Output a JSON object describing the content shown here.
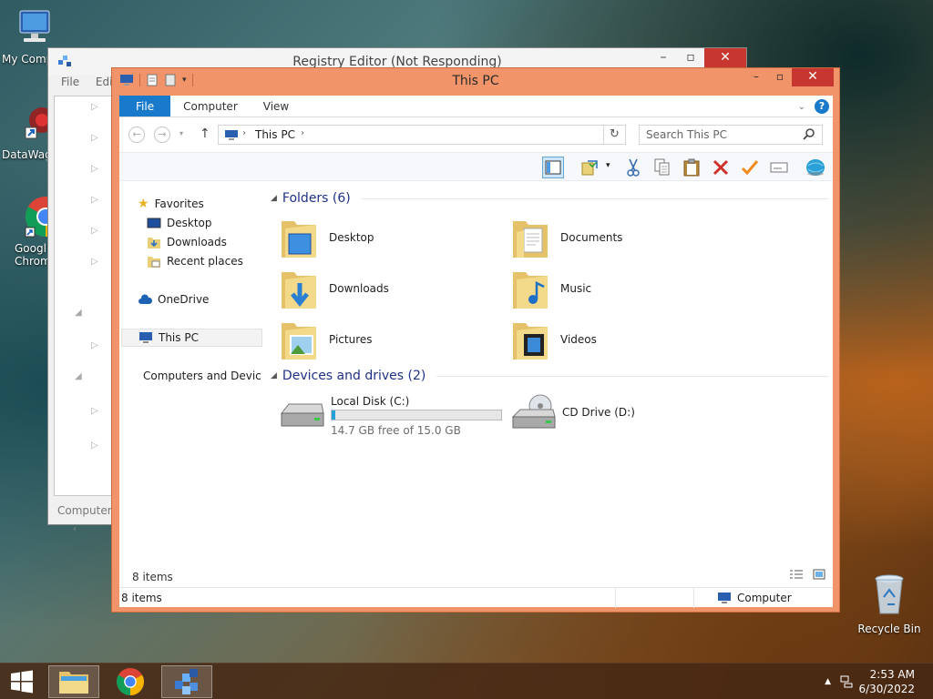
{
  "desktop": {
    "icons": [
      {
        "label": "My Comp",
        "icon": "computer-icon"
      },
      {
        "label": "DataWag",
        "icon": "datawag-icon"
      },
      {
        "label": "Googl Chrom",
        "icon": "chrome-icon"
      },
      {
        "label": "Recycle Bin",
        "icon": "recycle-bin-icon"
      }
    ]
  },
  "regedit": {
    "title": "Registry Editor (Not Responding)",
    "menu": [
      "File",
      "Edit"
    ],
    "status": "Computer\\"
  },
  "explorer": {
    "title": "This PC",
    "tabs": {
      "file": "File",
      "computer": "Computer",
      "view": "View"
    },
    "address": {
      "crumb": "This PC"
    },
    "search": {
      "placeholder": "Search This PC"
    },
    "nav": {
      "favorites": "Favorites",
      "desktop": "Desktop",
      "downloads": "Downloads",
      "recent": "Recent places",
      "onedrive": "OneDrive",
      "thispc": "This PC",
      "network": "Computers and Devices"
    },
    "folders_header": "Folders (6)",
    "folders": [
      {
        "name": "Desktop"
      },
      {
        "name": "Documents"
      },
      {
        "name": "Downloads"
      },
      {
        "name": "Music"
      },
      {
        "name": "Pictures"
      },
      {
        "name": "Videos"
      }
    ],
    "devices_header": "Devices and drives (2)",
    "drives": {
      "c": {
        "name": "Local Disk (C:)",
        "free": "14.7 GB free of 15.0 GB",
        "used_fraction": 0.02
      },
      "d": {
        "name": "CD Drive (D:)"
      }
    },
    "item_count_inline": "8 items",
    "status_left": "8 items",
    "status_right": "Computer"
  },
  "taskbar": {
    "time": "2:53 AM",
    "date": "6/30/2022"
  },
  "colors": {
    "accent": "#1979ca",
    "window_frame": "#f1946a",
    "close_button": "#c7372f"
  }
}
